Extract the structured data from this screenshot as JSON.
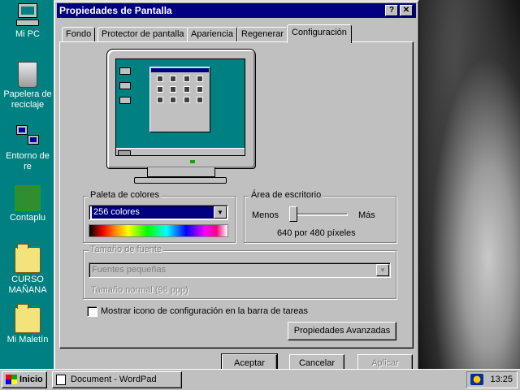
{
  "desktop": {
    "icons": [
      {
        "label": "Mi PC",
        "icon": "computer-icon"
      },
      {
        "label": "Papelera de reciclaje",
        "icon": "recycle-bin-icon"
      },
      {
        "label": "Entorno de re",
        "icon": "network-icon"
      },
      {
        "label": "Contaplu",
        "icon": "app-icon"
      },
      {
        "label": "CURSO MAÑANA",
        "icon": "folder-icon"
      },
      {
        "label": "Mi Maletín",
        "icon": "briefcase-icon"
      }
    ]
  },
  "dialog": {
    "title": "Propiedades de Pantalla",
    "help_glyph": "?",
    "close_glyph": "✕",
    "tabs": [
      {
        "label": "Fondo",
        "active": false
      },
      {
        "label": "Protector de pantalla",
        "active": false
      },
      {
        "label": "Apariencia",
        "active": false
      },
      {
        "label": "Regenerar",
        "active": false
      },
      {
        "label": "Configuración",
        "active": true
      }
    ],
    "palette": {
      "label": "Paleta de colores",
      "value": "256 colores"
    },
    "desktop_area": {
      "label": "Área de escritorio",
      "less": "Menos",
      "more": "Más",
      "resolution": "640 por 480 píxeles",
      "slider_level": 0
    },
    "font_size": {
      "label": "Tamaño de fuente",
      "value": "Fuentes pequeñas",
      "note": "Tamaño normal (96 ppp)"
    },
    "show_icon": {
      "label": "Mostrar icono de configuración en la barra de tareas",
      "checked": false
    },
    "buttons": {
      "advanced": "Propiedades Avanzadas",
      "ok": "Aceptar",
      "cancel": "Cancelar",
      "apply": "Aplicar"
    }
  },
  "taskbar": {
    "start": "Inicio",
    "tasks": [
      {
        "label": "Document - WordPad"
      }
    ],
    "clock": "13:25"
  },
  "colors": {
    "desktop": "#008080",
    "titlebar": "#000080",
    "face": "#c0c0c0",
    "selection": "#000080"
  }
}
